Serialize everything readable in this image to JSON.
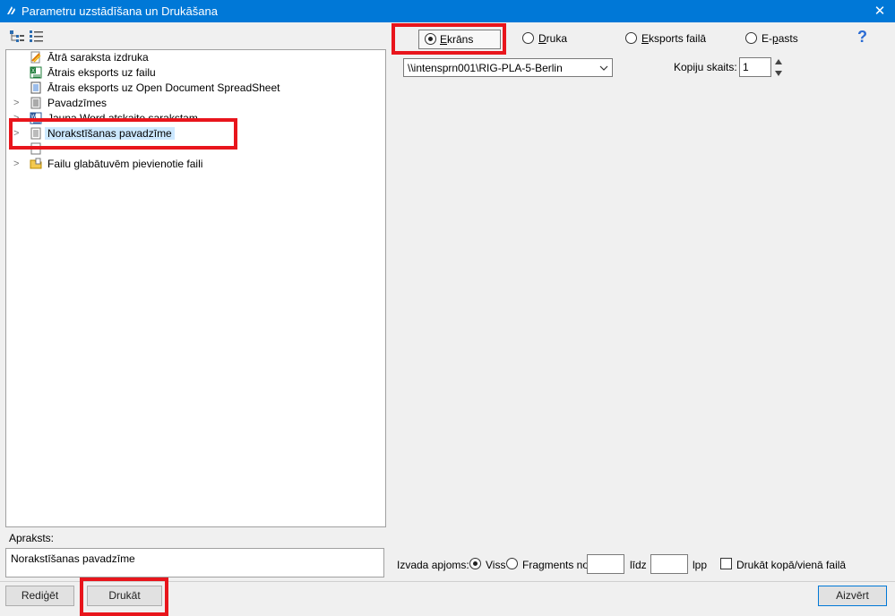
{
  "window": {
    "title": "Parametru uzstādīšana un Drukāšana",
    "close_glyph": "✕"
  },
  "tree": {
    "items": [
      {
        "label": "Ātrā saraksta izdruka",
        "icon": "quick-print-icon",
        "expandable": false
      },
      {
        "label": "Ātrais eksports uz failu",
        "icon": "excel-export-icon",
        "expandable": false
      },
      {
        "label": "Ātrais eksports uz Open Document SpreadSheet",
        "icon": "ods-export-icon",
        "expandable": false
      },
      {
        "label": "Pavadzīmes",
        "icon": "document-list-icon",
        "expandable": true
      },
      {
        "label": "Jauna Word atskaite sarakstam",
        "icon": "word-report-icon",
        "expandable": true
      },
      {
        "label": "Norakstīšanas pavadzīme",
        "icon": "document-icon",
        "expandable": true,
        "selected": true
      },
      {
        "label": "",
        "icon": "document-icon",
        "expandable": false
      },
      {
        "label": "Failu glabātuvēm pievienotie faili",
        "icon": "folder-attach-icon",
        "expandable": true
      }
    ]
  },
  "output": {
    "options": [
      {
        "key": "ekrans",
        "pre": "",
        "u": "E",
        "post": "krāns",
        "selected": true
      },
      {
        "key": "druka",
        "pre": "",
        "u": "D",
        "post": "ruka",
        "selected": false
      },
      {
        "key": "eksports",
        "pre": "",
        "u": "E",
        "post": "ksports failā",
        "selected": false
      },
      {
        "key": "epasts",
        "pre": "E-",
        "u": "p",
        "post": "asts",
        "selected": false
      }
    ],
    "help_glyph": "?"
  },
  "printer": {
    "value": "\\\\intensprn001\\RIG-PLA-5-Berlin"
  },
  "copies": {
    "label": "Kopiju skaits:",
    "value": "1"
  },
  "description": {
    "label": "Apraksts:",
    "text": "Norakstīšanas pavadzīme"
  },
  "range": {
    "label": "Izvada apjoms:",
    "all_label": "Viss",
    "fragment_label": "Fragments no",
    "to_label": "līdz",
    "page_label": "lpp",
    "all_selected": true,
    "from_value": "",
    "to_value": ""
  },
  "combine": {
    "label": "Drukāt kopā/vienā failā",
    "checked": false
  },
  "buttons": {
    "edit": "Rediģēt",
    "print": "Drukāt",
    "close": "Aizvērt"
  },
  "colors": {
    "titlebar": "#0078d7",
    "highlight": "#e8151c",
    "selection": "#cce8ff"
  }
}
